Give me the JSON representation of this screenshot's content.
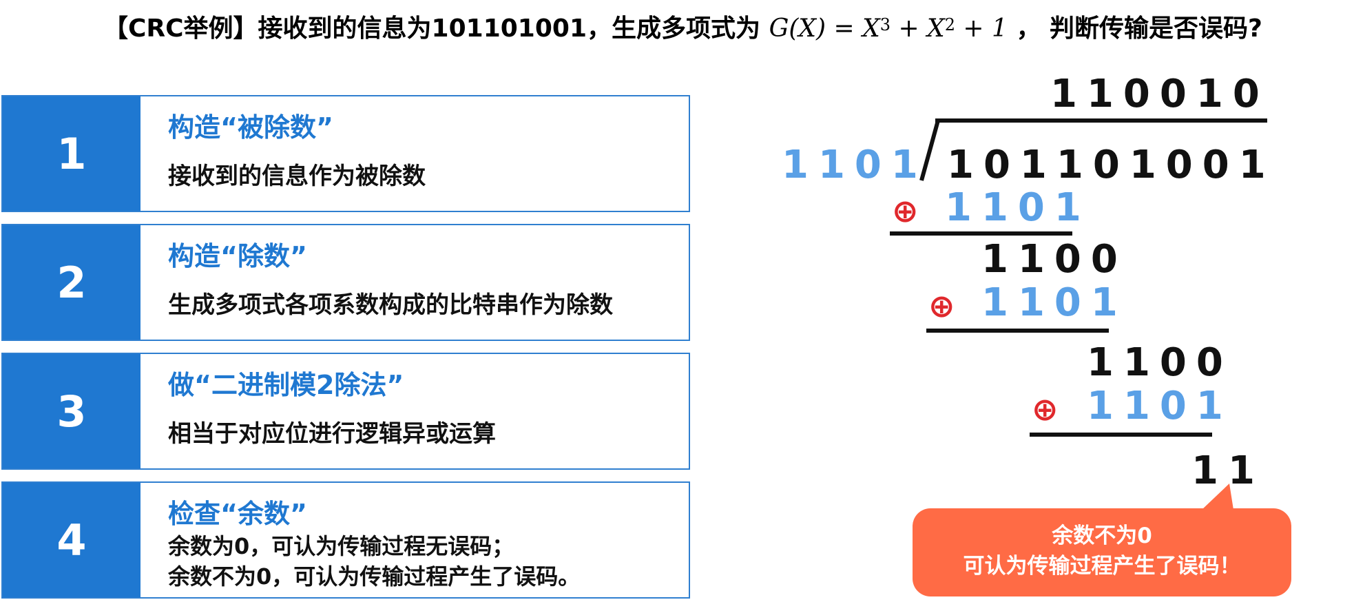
{
  "title": {
    "prefix": "【CRC举例】接收到的信息为101101001，生成多项式为",
    "math": "G(X) = X³ + X² + 1",
    "suffix": "，  判断传输是否误码?"
  },
  "steps": [
    {
      "number": "1",
      "heading": "构造“被除数”",
      "description": "接收到的信息作为被除数"
    },
    {
      "number": "2",
      "heading": "构造“除数”",
      "description": "生成多项式各项系数构成的比特串作为除数"
    },
    {
      "number": "3",
      "heading": "做“二进制模2除法”",
      "description": "相当于对应位进行逻辑异或运算"
    },
    {
      "number": "4",
      "heading": "检查“余数”",
      "description_line1": "余数为0，可认为传输过程无误码；",
      "description_line2": "余数不为0，可认为传输过程产生了误码。"
    }
  ],
  "division": {
    "quotient": "110010",
    "divisor": "1101",
    "dividend": "101101001",
    "xor_symbol": "⊕",
    "rows": [
      {
        "subtrahend": "1101"
      },
      {
        "partial": "1100",
        "subtrahend": "1101"
      },
      {
        "partial": "1100",
        "subtrahend": "1101"
      }
    ],
    "remainder": "11"
  },
  "callout": {
    "line1": "余数不为0",
    "line2": "可认为传输过程产生了误码！"
  },
  "colors": {
    "step_blue": "#1f78d1",
    "divisor_blue": "#5aa0e6",
    "xor_red": "#e0282c",
    "callout_orange": "#ff6b45"
  }
}
